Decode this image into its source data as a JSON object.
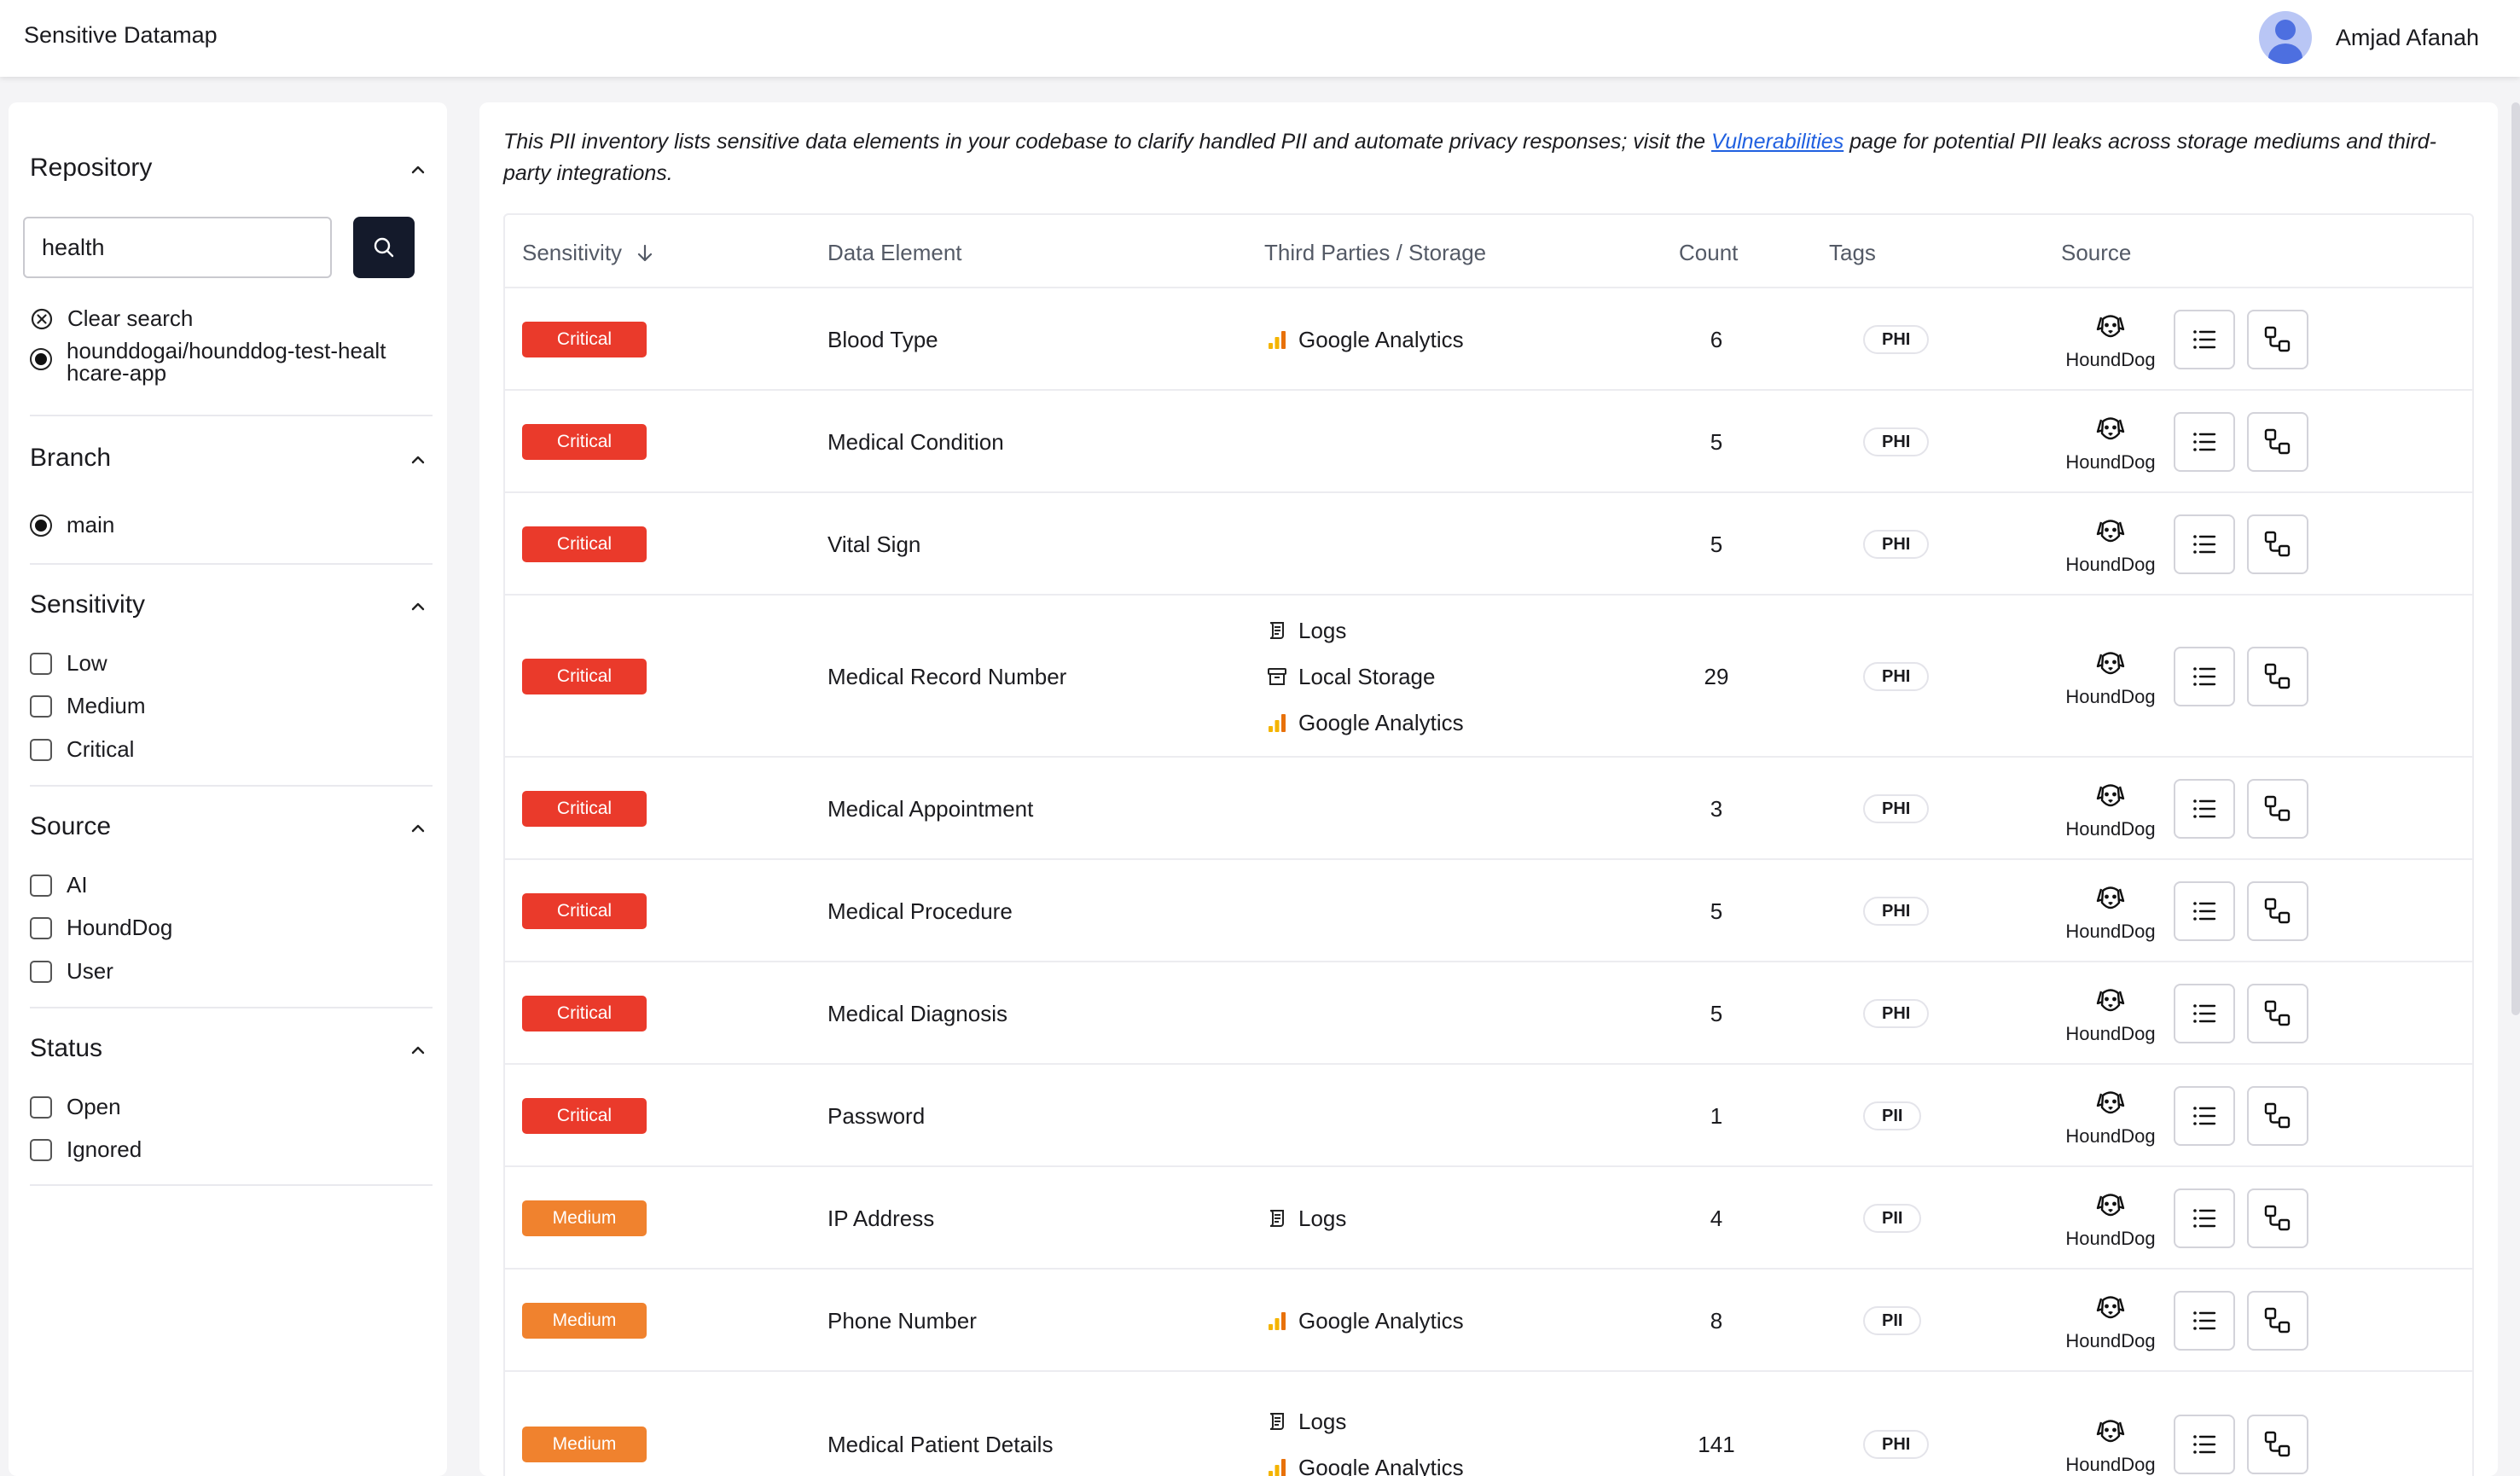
{
  "header": {
    "title": "Sensitive Datamap",
    "user_name": "Amjad Afanah"
  },
  "sidebar": {
    "repository": {
      "title": "Repository",
      "search_value": "health",
      "clear_label": "Clear search",
      "option": "hounddogai/hounddog-test-healthcare-app"
    },
    "branch": {
      "title": "Branch",
      "option": "main"
    },
    "sensitivity": {
      "title": "Sensitivity",
      "options": [
        "Low",
        "Medium",
        "Critical"
      ]
    },
    "source": {
      "title": "Source",
      "options": [
        "AI",
        "HoundDog",
        "User"
      ]
    },
    "status": {
      "title": "Status",
      "options": [
        "Open",
        "Ignored"
      ]
    }
  },
  "intro": {
    "before": "This PII inventory lists sensitive data elements in your codebase to clarify handled PII and automate privacy responses; visit the ",
    "link": "Vulnerabilities",
    "after": " page for potential PII leaks across storage mediums and third-party integrations."
  },
  "table": {
    "columns": [
      "Sensitivity",
      "Data Element",
      "Third Parties / Storage",
      "Count",
      "Tags",
      "Source"
    ],
    "rows": [
      {
        "sensitivity": "Critical",
        "element": "Blood Type",
        "third_parties": [
          "Google Analytics"
        ],
        "count": "6",
        "tag": "PHI",
        "source": "HoundDog"
      },
      {
        "sensitivity": "Critical",
        "element": "Medical Condition",
        "third_parties": [],
        "count": "5",
        "tag": "PHI",
        "source": "HoundDog"
      },
      {
        "sensitivity": "Critical",
        "element": "Vital Sign",
        "third_parties": [],
        "count": "5",
        "tag": "PHI",
        "source": "HoundDog"
      },
      {
        "sensitivity": "Critical",
        "element": "Medical Record Number",
        "third_parties": [
          "Logs",
          "Local Storage",
          "Google Analytics"
        ],
        "count": "29",
        "tag": "PHI",
        "source": "HoundDog"
      },
      {
        "sensitivity": "Critical",
        "element": "Medical Appointment",
        "third_parties": [],
        "count": "3",
        "tag": "PHI",
        "source": "HoundDog"
      },
      {
        "sensitivity": "Critical",
        "element": "Medical Procedure",
        "third_parties": [],
        "count": "5",
        "tag": "PHI",
        "source": "HoundDog"
      },
      {
        "sensitivity": "Critical",
        "element": "Medical Diagnosis",
        "third_parties": [],
        "count": "5",
        "tag": "PHI",
        "source": "HoundDog"
      },
      {
        "sensitivity": "Critical",
        "element": "Password",
        "third_parties": [],
        "count": "1",
        "tag": "PII",
        "source": "HoundDog"
      },
      {
        "sensitivity": "Medium",
        "element": "IP Address",
        "third_parties": [
          "Logs"
        ],
        "count": "4",
        "tag": "PII",
        "source": "HoundDog"
      },
      {
        "sensitivity": "Medium",
        "element": "Phone Number",
        "third_parties": [
          "Google Analytics"
        ],
        "count": "8",
        "tag": "PII",
        "source": "HoundDog"
      },
      {
        "sensitivity": "Medium",
        "element": "Medical Patient Details",
        "third_parties": [
          "Logs",
          "Google Analytics"
        ],
        "count": "141",
        "tag": "PHI",
        "source": "HoundDog"
      }
    ]
  },
  "colors": {
    "critical": "#ea3a2b",
    "medium": "#f0822e",
    "link": "#2060e0",
    "search_button": "#141a2b"
  },
  "icons": {
    "sort": "arrow-down-icon",
    "search": "magnifier-icon",
    "google_analytics": "bar-chart-icon",
    "logs": "scroll-icon",
    "local_storage": "archive-box-icon",
    "houndDog": "dog-face-icon",
    "details": "list-icon",
    "flow": "flow-nodes-icon"
  }
}
